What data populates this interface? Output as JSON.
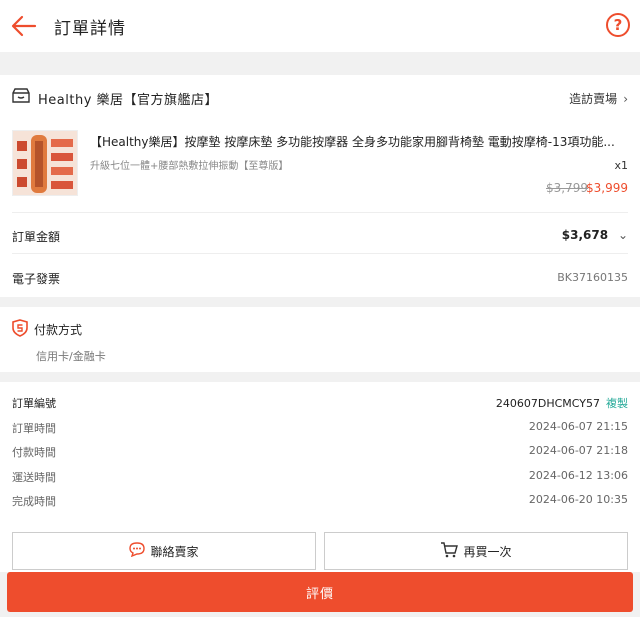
{
  "header": {
    "title": "訂單詳情",
    "help_icon": "?"
  },
  "shop": {
    "name": "Healthy 樂居【官方旗艦店】",
    "visit_label": "造訪賣場",
    "product": {
      "name": "【Healthy樂居】按摩墊 按摩床墊 多功能按摩器 全身多功能家用腳背椅墊 電動按摩椅-13項功能...",
      "variant": "升級七位一體+腰部熱敷拉伸振動【至尊版】",
      "qty": "x1",
      "price_original": "$3,799",
      "price_sale": "$3,999"
    }
  },
  "summary": {
    "total_label": "訂單金額",
    "total_value": "$3,678",
    "invoice_label": "電子發票",
    "invoice_value": "BK37160135"
  },
  "payment": {
    "title": "付款方式",
    "method": "信用卡/金融卡"
  },
  "order_info": {
    "order_no_label": "訂單編號",
    "order_no": "240607DHCMCY57",
    "copy_label": "複製",
    "rows": [
      {
        "label": "訂單時間",
        "value": "2024-06-07 21:15"
      },
      {
        "label": "付款時間",
        "value": "2024-06-07 21:18"
      },
      {
        "label": "運送時間",
        "value": "2024-06-12 13:06"
      },
      {
        "label": "完成時間",
        "value": "2024-06-20 10:35"
      }
    ]
  },
  "actions": {
    "contact_label": "聯絡賣家",
    "rebuy_label": "再買一次",
    "review_label": "評價"
  },
  "colors": {
    "accent": "#ee4d2d",
    "copy": "#26aa99"
  }
}
